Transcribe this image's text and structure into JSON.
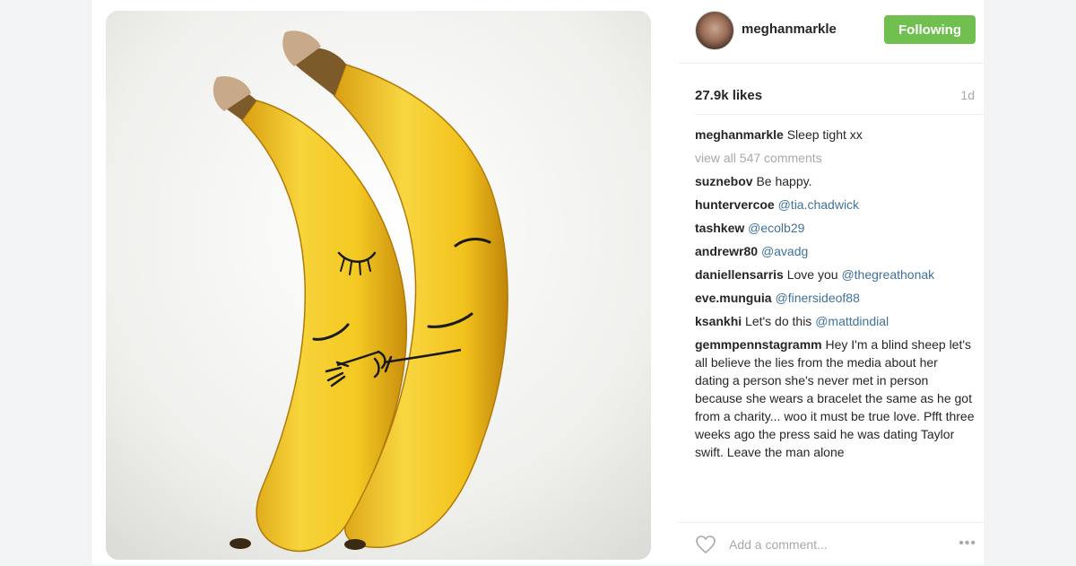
{
  "post": {
    "username": "meghanmarkle",
    "follow_label": "Following",
    "likes": "27.9k likes",
    "age": "1d",
    "caption_user": "meghanmarkle",
    "caption_text": " Sleep tight xx",
    "view_all": "view all 547 comments",
    "comments": [
      {
        "user": "suznebov",
        "text": " Be happy.",
        "mention": ""
      },
      {
        "user": "huntervercoe",
        "text": " ",
        "mention": "@tia.chadwick"
      },
      {
        "user": "tashkew",
        "text": " ",
        "mention": "@ecolb29"
      },
      {
        "user": "andrewr80",
        "text": " ",
        "mention": "@avadg"
      },
      {
        "user": "daniellensarris",
        "text": " Love you ",
        "mention": "@thegreathonak"
      },
      {
        "user": "eve.munguia",
        "text": " ",
        "mention": "@finersideof88"
      },
      {
        "user": "ksankhi",
        "text": " Let's do this ",
        "mention": "@mattdindial"
      }
    ],
    "long_comment": {
      "user": "gemmpennstagramm",
      "text": " Hey I'm a blind sheep let's all believe the lies from the media about her dating a person she's never met in person because she wears a bracelet the same as he got from a charity... woo it must be true love. Pfft three weeks ago the press said he was dating Taylor swift. Leave the man alone"
    },
    "add_comment_placeholder": "Add a comment...",
    "more_icon": "•••"
  },
  "colors": {
    "follow_button": "#70c050",
    "mention": "#3f729b",
    "muted": "#a8a8a8",
    "banana": "#f6d132"
  },
  "icons": [
    "heart-icon",
    "more-options-icon"
  ]
}
